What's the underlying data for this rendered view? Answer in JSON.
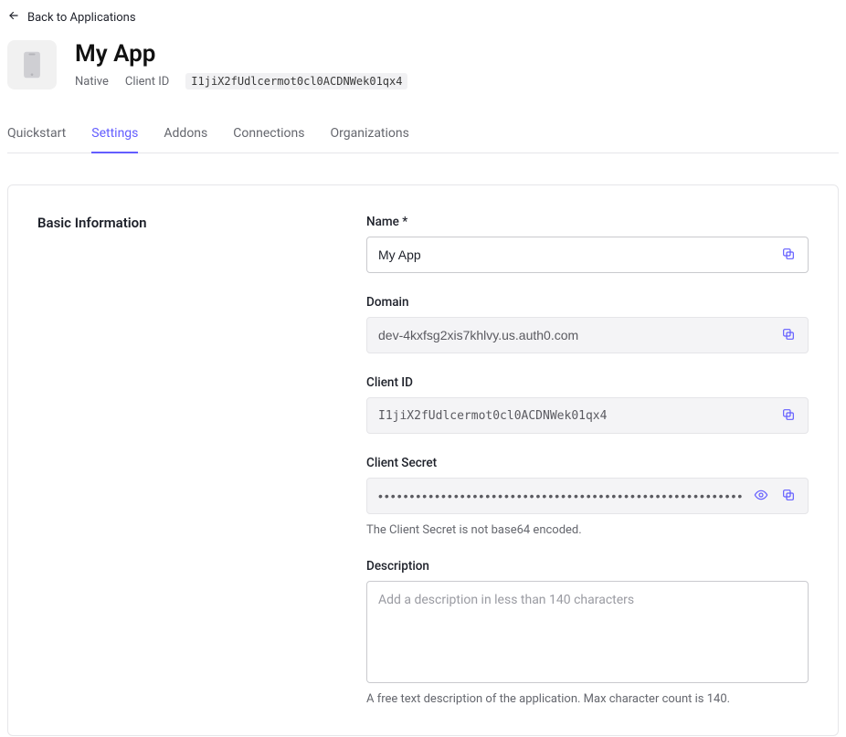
{
  "back_link": "Back to Applications",
  "app": {
    "title": "My App",
    "type": "Native",
    "client_id_label": "Client ID",
    "client_id": "I1jiX2fUdlcermot0cl0ACDNWek01qx4"
  },
  "tabs": {
    "quickstart": "Quickstart",
    "settings": "Settings",
    "addons": "Addons",
    "connections": "Connections",
    "organizations": "Organizations"
  },
  "section": {
    "basic_info": "Basic Information"
  },
  "fields": {
    "name_label": "Name *",
    "name_value": "My App",
    "domain_label": "Domain",
    "domain_value": "dev-4kxfsg2xis7khlvy.us.auth0.com",
    "client_id_label": "Client ID",
    "client_id_value": "I1jiX2fUdlcermot0cl0ACDNWek01qx4",
    "client_secret_label": "Client Secret",
    "client_secret_masked": "••••••••••••••••••••••••••••••••••••••••••••••••••••••••••••••••",
    "client_secret_help": "The Client Secret is not base64 encoded.",
    "description_label": "Description",
    "description_placeholder": "Add a description in less than 140 characters",
    "description_help": "A free text description of the application. Max character count is 140."
  }
}
